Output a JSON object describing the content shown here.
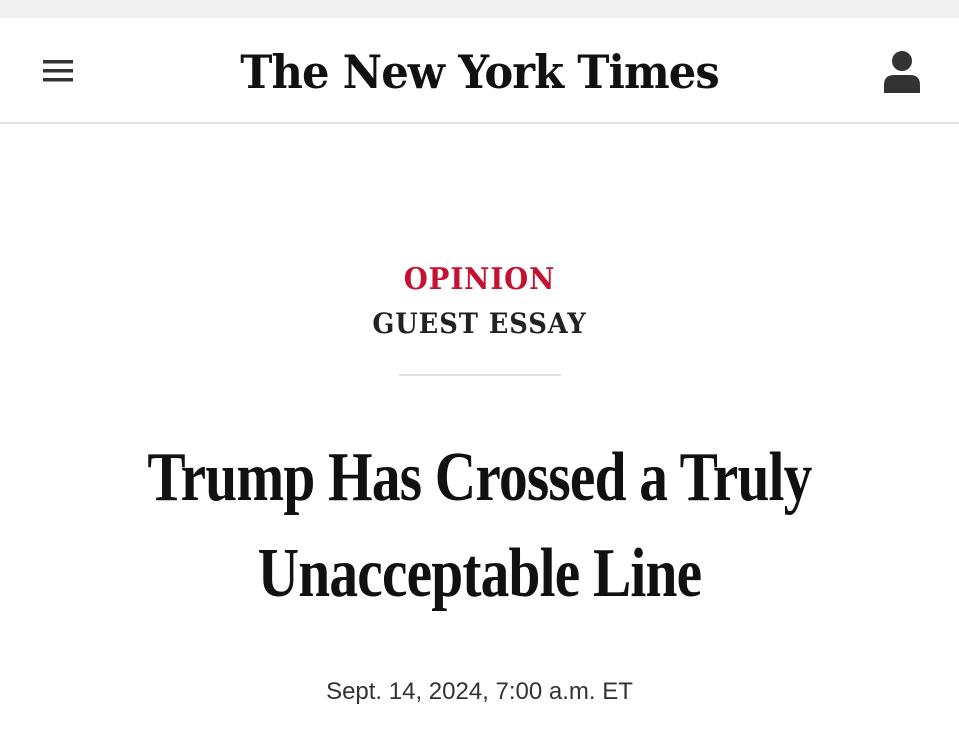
{
  "header": {
    "masthead": "The New York Times",
    "menu_icon": "hamburger-menu-icon",
    "account_icon": "user-account-icon"
  },
  "article": {
    "kicker": "OPINION",
    "section": "GUEST ESSAY",
    "headline": "Trump Has Crossed a Truly Unacceptable Line",
    "timestamp": "Sept. 14, 2024, 7:00 a.m. ET"
  },
  "colors": {
    "kicker": "#c41230",
    "text": "#111111",
    "divider": "#e0e0e0"
  }
}
